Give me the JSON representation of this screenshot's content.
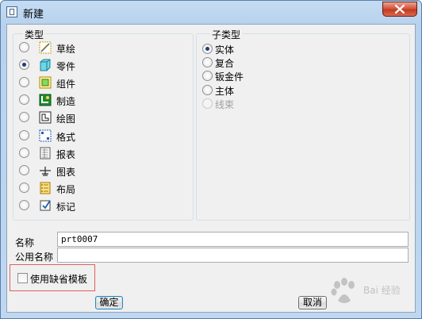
{
  "window": {
    "title": "新建"
  },
  "type_group": {
    "legend": "类型",
    "items": [
      {
        "label": "草绘",
        "icon": "sketch-icon",
        "selected": false
      },
      {
        "label": "零件",
        "icon": "part-icon",
        "selected": true
      },
      {
        "label": "组件",
        "icon": "assembly-icon",
        "selected": false
      },
      {
        "label": "制造",
        "icon": "manufacturing-icon",
        "selected": false
      },
      {
        "label": "绘图",
        "icon": "drawing-icon",
        "selected": false
      },
      {
        "label": "格式",
        "icon": "format-icon",
        "selected": false
      },
      {
        "label": "报表",
        "icon": "report-icon",
        "selected": false
      },
      {
        "label": "图表",
        "icon": "diagram-icon",
        "selected": false
      },
      {
        "label": "布局",
        "icon": "layout-icon",
        "selected": false
      },
      {
        "label": "标记",
        "icon": "markup-icon",
        "selected": false
      }
    ]
  },
  "subtype_group": {
    "legend": "子类型",
    "items": [
      {
        "label": "实体",
        "selected": true,
        "disabled": false
      },
      {
        "label": "复合",
        "selected": false,
        "disabled": false
      },
      {
        "label": "钣金件",
        "selected": false,
        "disabled": false
      },
      {
        "label": "主体",
        "selected": false,
        "disabled": false
      },
      {
        "label": "线束",
        "selected": false,
        "disabled": true
      }
    ]
  },
  "name_field": {
    "label": "名称",
    "value": "prt0007"
  },
  "common_name_field": {
    "label": "公用名称",
    "value": ""
  },
  "default_template_checkbox": {
    "label": "使用缺省模板",
    "checked": false
  },
  "buttons": {
    "ok": "确定",
    "cancel": "取消"
  },
  "watermark": {
    "text": "Bai 经验"
  },
  "colors": {
    "highlight_box": "#e06060",
    "selected_radio": "#1d3f75"
  }
}
